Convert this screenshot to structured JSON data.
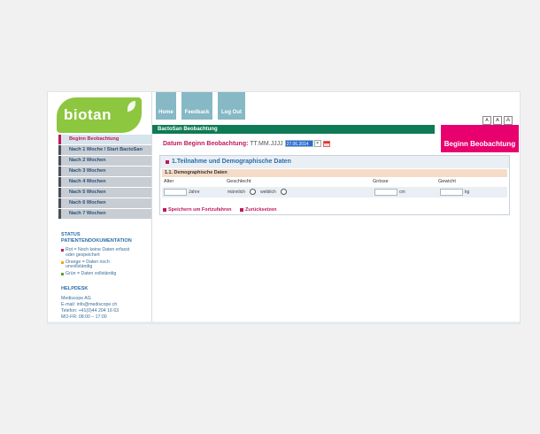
{
  "brand": {
    "logo_text": "biotan"
  },
  "top_nav": [
    {
      "label": "Home"
    },
    {
      "label": "Feedback"
    },
    {
      "label": "Log Out"
    }
  ],
  "font_size_buttons": [
    "A",
    "A",
    "A"
  ],
  "sidebar": {
    "items": [
      {
        "label": "Beginn Beobachtung",
        "active": true
      },
      {
        "label": "Nach 1 Woche / Start BactoSan",
        "active": false
      },
      {
        "label": "Nach 2 Wochen",
        "active": false
      },
      {
        "label": "Nach 3 Wochen",
        "active": false
      },
      {
        "label": "Nach 4 Wochen",
        "active": false
      },
      {
        "label": "Nach 5 Wochen",
        "active": false
      },
      {
        "label": "Nach 6 Wochen",
        "active": false
      },
      {
        "label": "Nach 7 Wochen",
        "active": false
      }
    ],
    "status": {
      "title_line1": "STATUS",
      "title_line2": "PATIENTENDOKUMENTATION",
      "legend": [
        {
          "line1": "Rot = Noch keine Daten erfasst",
          "line2": "oder gespeichert",
          "color": "#c2185b"
        },
        {
          "line1": "Orange = Daten noch",
          "line2": "unvollständig",
          "color": "#f2a900"
        },
        {
          "line1": "Grün = Daten vollständig",
          "line2": "",
          "color": "#5aa02c"
        }
      ]
    },
    "helpdesk": {
      "title": "HELPDESK",
      "lines": [
        "Mediscope AG",
        "E-mail: info@mediscope.ch",
        "Telefon: +41(0)44 204 16 63",
        "MO-FR: 08:00 – 17:00"
      ]
    }
  },
  "main": {
    "section_bar": "BactoSan Beobachtung",
    "cta": "Beginn Beobachtung",
    "datum": {
      "label": "Datum Beginn Beobachtung:",
      "format": "TT.MM.JJJJ",
      "value": "27.06.2014",
      "clear": "×"
    },
    "panel": {
      "title": "1.Teilnahme und Demographische Daten",
      "subheading": "1.1. Demographische Daten",
      "columns": {
        "alter": "Alter",
        "geschlecht": "Geschlecht",
        "groesse": "Grösse",
        "gewicht": "Gewicht"
      },
      "units": {
        "alter": "Jahre",
        "groesse": "cm",
        "gewicht": "kg"
      },
      "gender_options": {
        "male": "männlich",
        "female": "weiblich"
      }
    },
    "actions": {
      "save": "Speichern um Fortzufahren",
      "reset": "Zurücksetzen"
    }
  }
}
